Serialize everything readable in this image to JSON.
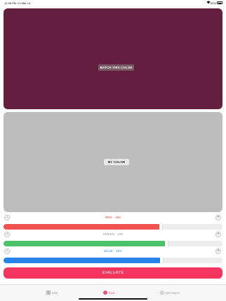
{
  "status_bar": {
    "time": "12:38 PM",
    "date": "Fri Mar 13",
    "battery": "60%"
  },
  "target_swatch": {
    "label": "MATCH THIS COLOR",
    "color": "#641e3e"
  },
  "my_swatch": {
    "label": "MY COLOR",
    "color": "#bdbdbd"
  },
  "sliders": [
    {
      "name": "RED · 183",
      "channel": "red",
      "value": 183,
      "max": 255,
      "fill_color": "#ef5350",
      "label_color": "#e53935",
      "minus": "−",
      "plus": "+"
    },
    {
      "name": "GREEN · 190",
      "channel": "green",
      "value": 190,
      "max": 255,
      "fill_color": "#4cc36a",
      "label_color": "#8e8e93",
      "minus": "−",
      "plus": "+"
    },
    {
      "name": "BLUE · 184",
      "channel": "blue",
      "value": 184,
      "max": 255,
      "fill_color": "#2684e8",
      "label_color": "#1e88e5",
      "minus": "−",
      "plus": "+"
    }
  ],
  "evaluate_button": {
    "label": "EVALUATE"
  },
  "tabs": [
    {
      "label": "HSB",
      "icon": "grid-icon",
      "active": false
    },
    {
      "label": "RGB",
      "icon": "rgb-circle-icon",
      "active": true
    },
    {
      "label": "SETTINGS",
      "icon": "gear-icon",
      "active": false
    }
  ],
  "colors": {
    "accent": "#f4355d"
  }
}
